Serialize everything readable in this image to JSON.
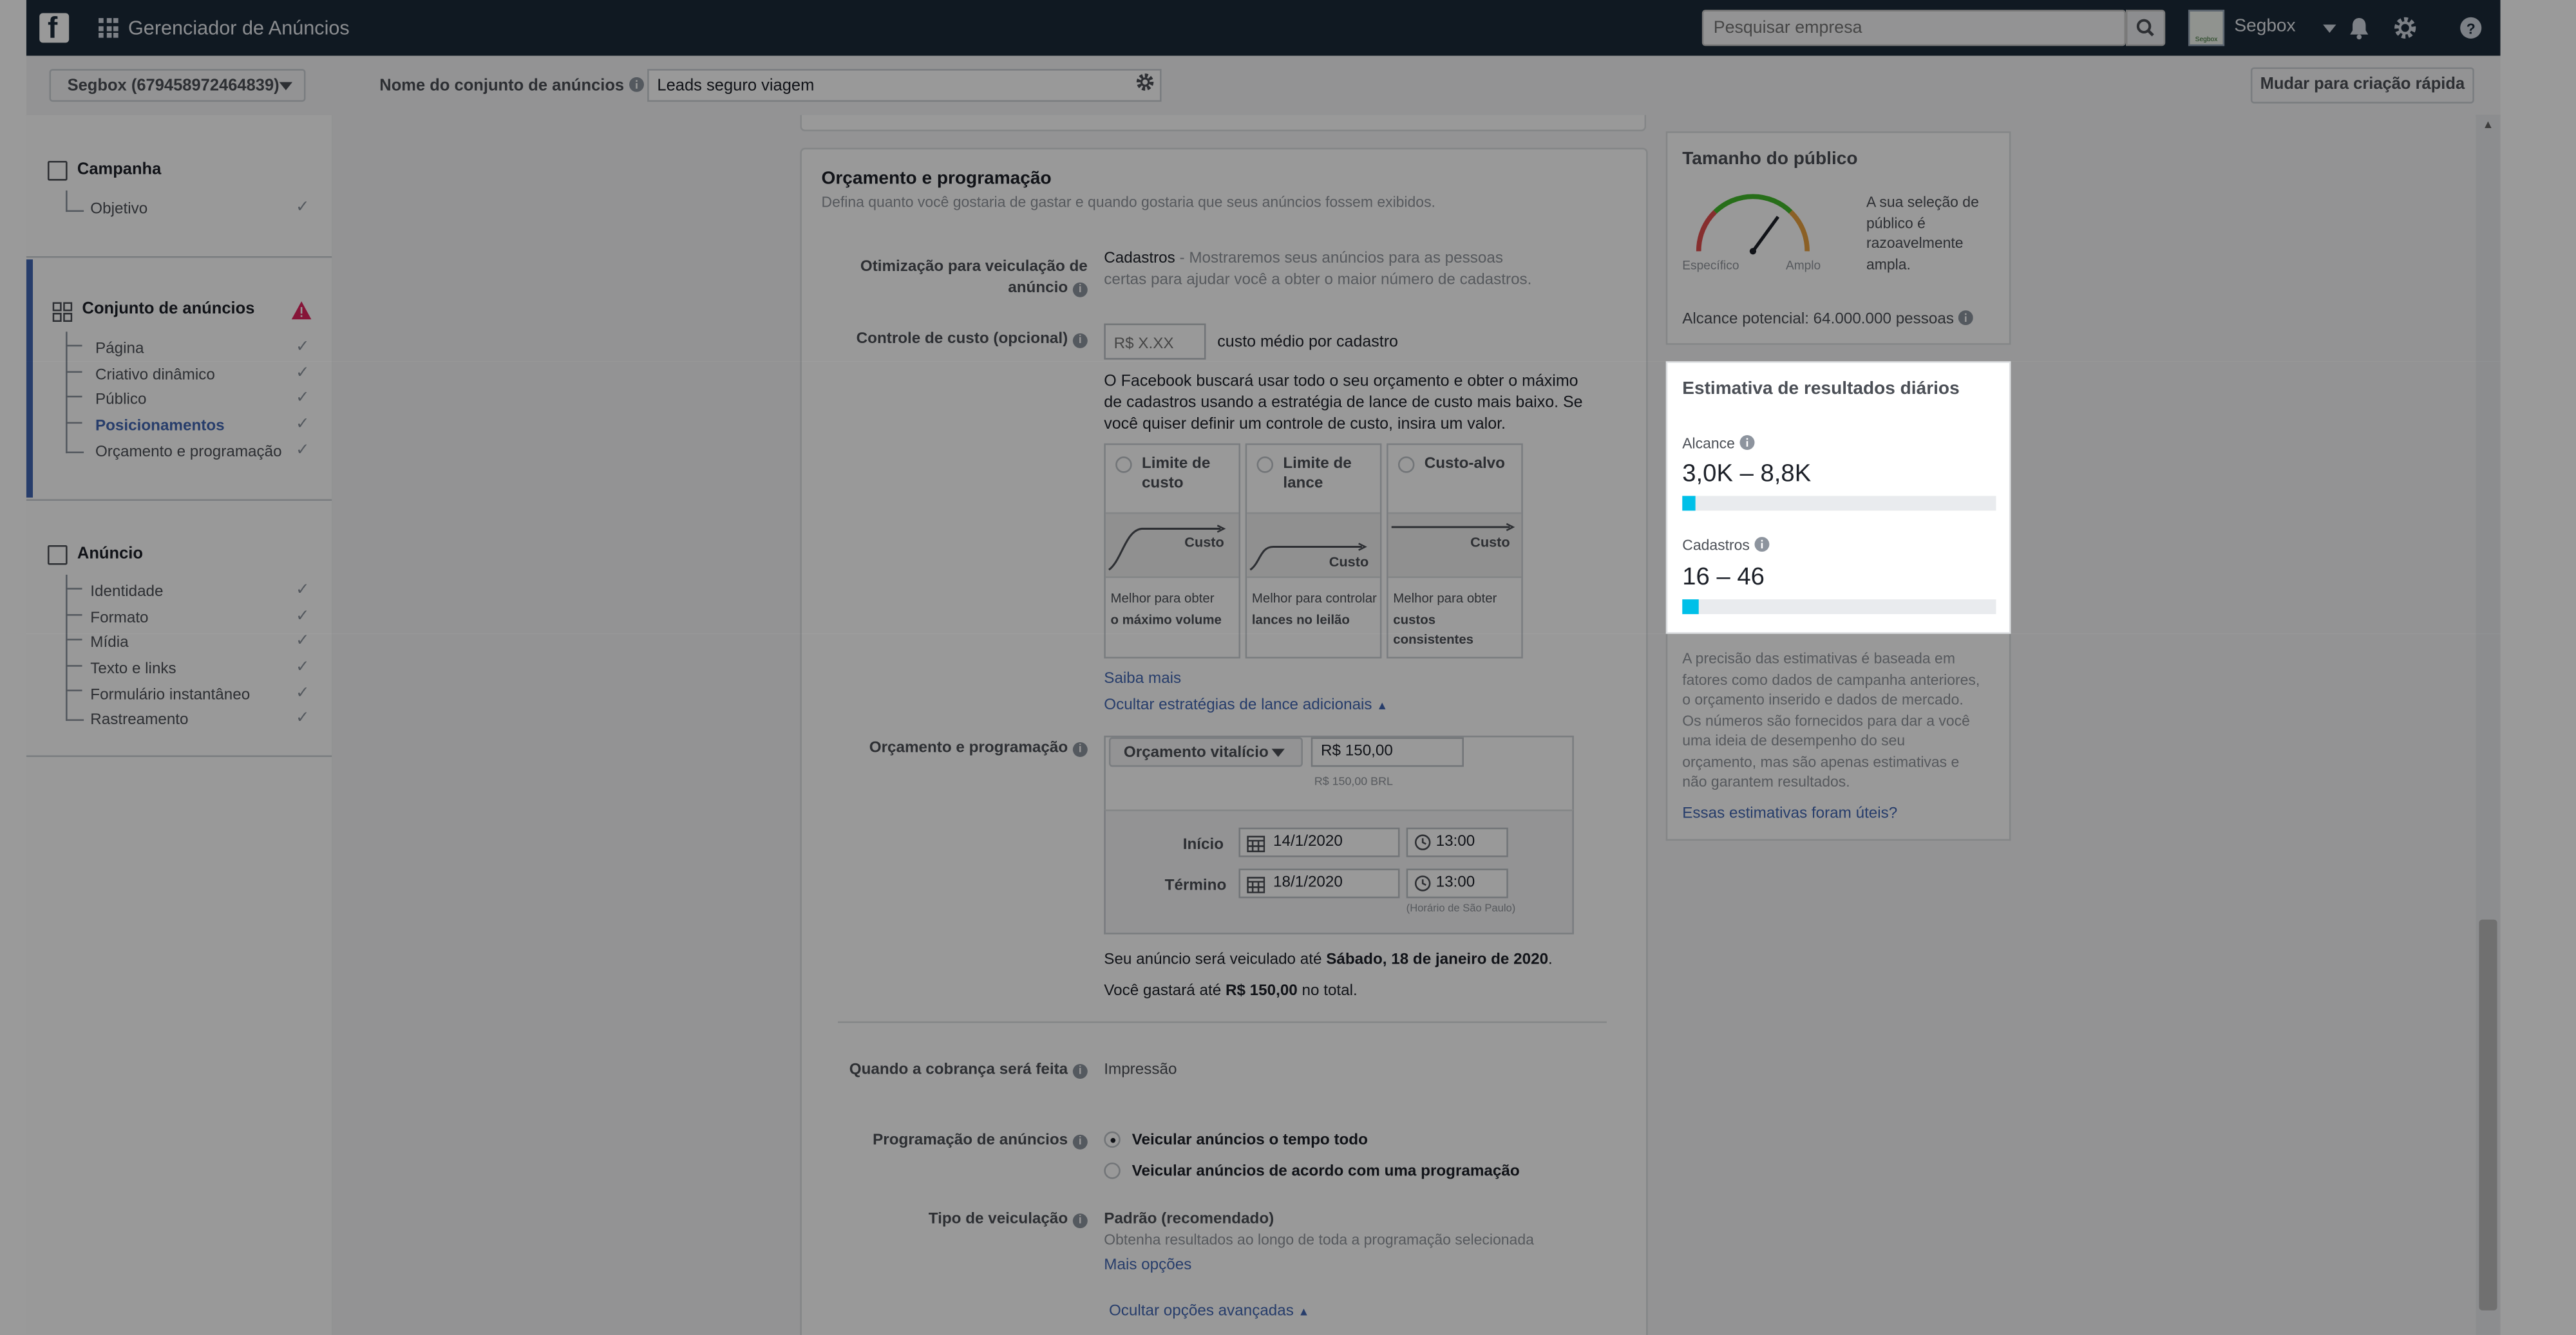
{
  "topbar": {
    "app_title": "Gerenciador de Anúncios",
    "search_placeholder": "Pesquisar empresa",
    "business_name": "Segbox",
    "business_logo_text": "Segbox"
  },
  "subbar": {
    "account_label": "Segbox (679458972464839)",
    "adset_name_label": "Nome do conjunto de anúncios",
    "adset_name_value": "Leads seguro viagem",
    "quick_create_label": "Mudar para criação rápida"
  },
  "nav": {
    "campaign": {
      "label": "Campanha",
      "items": [
        {
          "label": "Objetivo"
        }
      ]
    },
    "adset": {
      "label": "Conjunto de anúncios",
      "items": [
        {
          "label": "Página"
        },
        {
          "label": "Criativo dinâmico"
        },
        {
          "label": "Público"
        },
        {
          "label": "Posicionamentos"
        },
        {
          "label": "Orçamento e programação"
        }
      ]
    },
    "ad": {
      "label": "Anúncio",
      "items": [
        {
          "label": "Identidade"
        },
        {
          "label": "Formato"
        },
        {
          "label": "Mídia"
        },
        {
          "label": "Texto e links"
        },
        {
          "label": "Formulário instantâneo"
        },
        {
          "label": "Rastreamento"
        }
      ]
    }
  },
  "budget_section": {
    "title": "Orçamento e programação",
    "subtitle": "Defina quanto você gostaria de gastar e quando gostaria que seus anúncios fossem exibidos.",
    "optimization": {
      "label_l1": "Otimização para veiculação de",
      "label_l2": "anúncio",
      "value": "Cadastros",
      "desc_l1": " - Mostraremos seus anúncios para as pessoas",
      "desc_l2": "certas para ajudar você a obter o maior número de cadastros."
    },
    "cost_control": {
      "label": "Controle de custo (opcional)",
      "placeholder": "R$ X.XX",
      "unit": "custo médio por cadastro",
      "explain_l1": "O Facebook buscará usar todo o seu orçamento e obter o máximo",
      "explain_l2": "de cadastros usando a estratégia de lance de custo mais baixo. Se",
      "explain_l3": "você quiser definir um controle de custo, insira um valor."
    },
    "strategies": [
      {
        "title_l1": "Limite de",
        "title_l2": "custo",
        "graph_label": "Custo",
        "desc_l1": "Melhor para obter",
        "desc_l2": "o máximo volume",
        "desc_l3": ""
      },
      {
        "title_l1": "Limite de",
        "title_l2": "lance",
        "graph_label": "Custo",
        "desc_l1": "Melhor para controlar",
        "desc_l2": "lances no leilão",
        "desc_l3": ""
      },
      {
        "title_l1": "Custo-alvo",
        "title_l2": "",
        "graph_label": "Custo",
        "desc_l1": "Melhor para obter",
        "desc_l2": "custos",
        "desc_l3": "consistentes"
      }
    ],
    "learn_more": "Saiba mais",
    "hide_strategies": "Ocultar estratégias de lance adicionais",
    "budget": {
      "label": "Orçamento e programação",
      "type": "Orçamento vitalício",
      "amount": "R$ 150,00",
      "amount_note": "R$ 150,00 BRL",
      "start_label": "Início",
      "start_date": "14/1/2020",
      "start_time": "13:00",
      "end_label": "Término",
      "end_date": "18/1/2020",
      "end_time": "13:00",
      "timezone_note": "(Horário de São Paulo)"
    },
    "summary": {
      "run_pre": "Seu anúncio será veiculado até ",
      "run_bold": "Sábado, 18 de janeiro de 2020",
      "run_post": ".",
      "spend_pre": "Você gastará até ",
      "spend_bold": "R$ 150,00",
      "spend_post": " no total."
    },
    "charge": {
      "label": "Quando a cobrança será feita",
      "value": "Impressão"
    },
    "scheduling": {
      "label": "Programação de anúncios",
      "option1": "Veicular anúncios o tempo todo",
      "option2": "Veicular anúncios de acordo com uma programação"
    },
    "delivery": {
      "label": "Tipo de veiculação",
      "value": "Padrão (recomendado)",
      "desc": "Obtenha resultados ao longo de toda a programação selecionada",
      "more": "Mais opções"
    },
    "hide_advanced": "Ocultar opções avançadas"
  },
  "audience_size": {
    "title": "Tamanho do público",
    "gauge_left": "Específico",
    "gauge_right": "Amplo",
    "gauge_level": 0.7,
    "desc_l1": "A sua seleção de",
    "desc_l2": "público é",
    "desc_l3": "razoavelmente",
    "desc_l4": "ampla.",
    "potential_reach": "Alcance potencial: 64.000.000 pessoas"
  },
  "daily_results": {
    "title": "Estimativa de resultados diários",
    "reach_label": "Alcance",
    "reach_value": "3,0K – 8,8K",
    "reach_level": 0.04,
    "leads_label": "Cadastros",
    "leads_value": "16 – 46",
    "leads_level": 0.05,
    "bar_color": "#00c0e8"
  },
  "accuracy_note": {
    "l1": "A precisão das estimativas é baseada em",
    "l2": "fatores como dados de campanha anteriores,",
    "l3": "o orçamento inserido e dados de mercado.",
    "l4": "Os números são fornecidos para dar a você",
    "l5": "uma ideia de desempenho do seu",
    "l6": "orçamento, mas são apenas estimativas e",
    "l7": "não garantem resultados.",
    "feedback": "Essas estimativas foram úteis?"
  },
  "colors": {
    "topbar": "#1b2a3a",
    "link": "#4267b2",
    "warning": "#e0245e"
  }
}
